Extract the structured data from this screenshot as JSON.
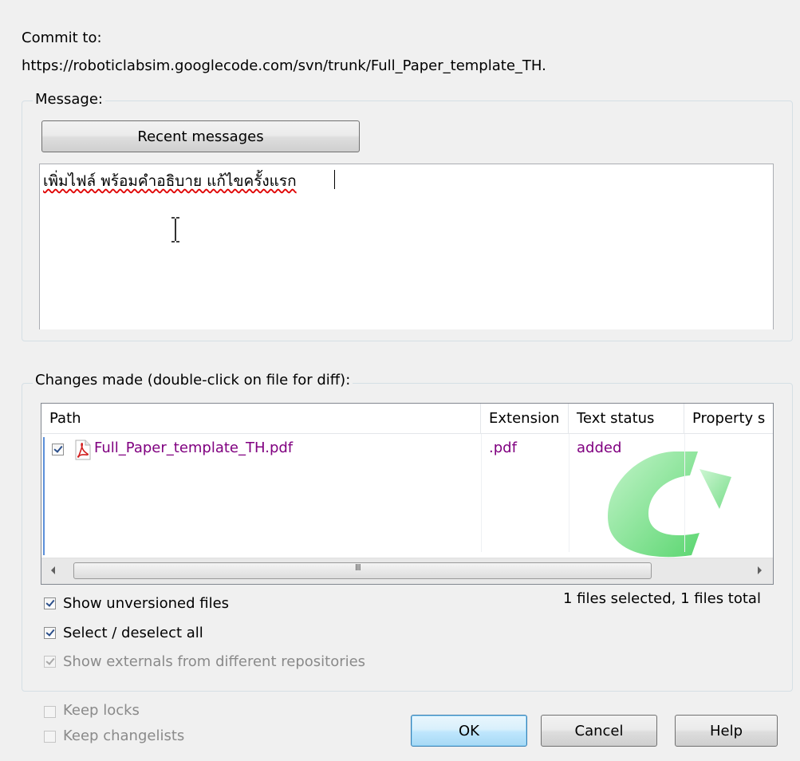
{
  "commit": {
    "label": "Commit to:",
    "url": "https://roboticlabsim.googlecode.com/svn/trunk/Full_Paper_template_TH."
  },
  "message_group": {
    "label": "Message:",
    "recent_button": "Recent messages",
    "text": "เพิ่มไฟล์ พร้อมคำอธิบาย แก้ไขครั้งแรก"
  },
  "changes_group": {
    "label": "Changes made (double-click on file for diff):",
    "columns": [
      "Path",
      "Extension",
      "Text status",
      "Property s"
    ],
    "rows": [
      {
        "path": "Full_Paper_template_TH.pdf",
        "extension": ".pdf",
        "text_status": "added",
        "property_status": "",
        "checked": true
      }
    ],
    "scroll_grip": "III",
    "selection_summary": "1 files selected, 1 files total",
    "options": {
      "show_unversioned": "Show unversioned files",
      "select_all": "Select / deselect all",
      "show_externals": "Show externals from different repositories"
    }
  },
  "footer": {
    "keep_locks": "Keep locks",
    "keep_changelists": "Keep changelists",
    "ok": "OK",
    "cancel": "Cancel",
    "help": "Help"
  },
  "colors": {
    "file_text": "#800080",
    "watermark_green": "#2ecc40"
  },
  "icons": {
    "file": "pdf-file-icon",
    "watermark": "tortoisesvn-watermark-icon"
  }
}
